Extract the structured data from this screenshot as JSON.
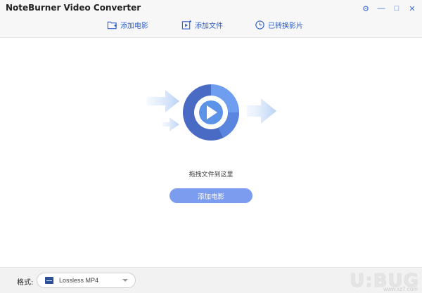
{
  "app": {
    "title": "NoteBurner Video Converter"
  },
  "window_controls": [
    {
      "name": "settings-icon",
      "glyph": "⚙"
    },
    {
      "name": "minimize-icon",
      "glyph": "—"
    },
    {
      "name": "maximize-icon",
      "glyph": "□"
    },
    {
      "name": "close-icon",
      "glyph": "✕"
    }
  ],
  "toolbar": {
    "add_movie": "添加电影",
    "add_file": "添加文件",
    "converted": "已转换影片"
  },
  "main": {
    "drop_hint": "拖拽文件到这里",
    "add_movie_button": "添加电影"
  },
  "footer": {
    "format_label": "格式:",
    "format_value": "Lossless MP4"
  },
  "watermark": {
    "text": "U:BUG",
    "sub": "www.xz7.com"
  },
  "colors": {
    "accent": "#3060c8",
    "button": "#7b9cef",
    "ring_dark": "#3f5fb8",
    "ring_light": "#6f9ef0"
  }
}
